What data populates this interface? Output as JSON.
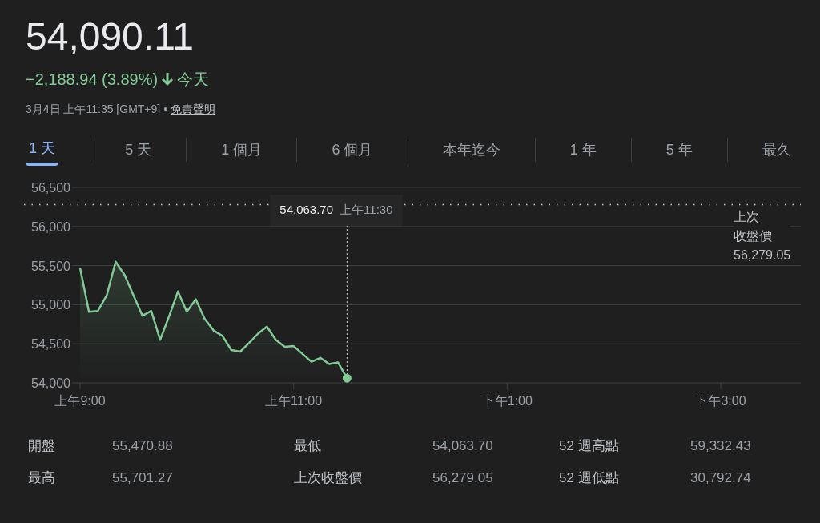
{
  "quote": {
    "price": "54,090.11",
    "change": "−2,188.94 (3.89%)",
    "period": "今天",
    "timestamp": "3月4日 上午11:35 [GMT+9]",
    "separator": "•",
    "disclaimer": "免責聲明"
  },
  "tabs": [
    {
      "label": "1 天",
      "selected": true
    },
    {
      "label": "5 天",
      "selected": false
    },
    {
      "label": "1 個月",
      "selected": false
    },
    {
      "label": "6 個月",
      "selected": false
    },
    {
      "label": "本年迄今",
      "selected": false
    },
    {
      "label": "1 年",
      "selected": false
    },
    {
      "label": "5 年",
      "selected": false
    },
    {
      "label": "最久",
      "selected": false
    }
  ],
  "chart": {
    "tooltip": {
      "value": "54,063.70",
      "time": "上午11:30"
    },
    "previous_close": {
      "label_lines": [
        "上次",
        "收盤價"
      ],
      "value": "56,279.05"
    },
    "chart_data": {
      "type": "line",
      "categories": [
        "上午9:00",
        null,
        null,
        null,
        null,
        null,
        null,
        null,
        null,
        null,
        null,
        null,
        null,
        null,
        null,
        null,
        null,
        null,
        null,
        null,
        null,
        null,
        null,
        null,
        "上午11:00",
        null,
        null,
        null,
        null,
        null,
        null,
        null,
        null,
        null,
        null,
        null,
        null,
        null,
        null,
        null,
        null,
        null,
        null,
        null,
        null,
        null,
        null,
        null,
        "下午1:00",
        null,
        null,
        null,
        null,
        null,
        null,
        null,
        null,
        null,
        null,
        null,
        null,
        null,
        null,
        null,
        null,
        null,
        null,
        null,
        null,
        null,
        null,
        null,
        "下午3:00",
        null,
        null,
        null,
        null,
        null,
        null,
        null,
        null,
        null
      ],
      "series": [
        {
          "color": "#81c995",
          "values": [
            55470,
            54910,
            54920,
            55120,
            55550,
            55380,
            55120,
            54860,
            54920,
            54550,
            54850,
            55170,
            54910,
            55070,
            54820,
            54670,
            54600,
            54420,
            54400,
            54510,
            54630,
            54720,
            54550,
            54460,
            54470,
            54370,
            54270,
            54320,
            54240,
            54260,
            54060,
            null,
            null,
            null,
            null,
            null,
            null,
            null,
            null,
            null,
            null,
            null,
            null,
            null,
            null,
            null,
            null,
            null,
            null,
            null,
            null,
            null,
            null,
            null,
            null,
            null,
            null,
            null,
            null,
            null,
            null,
            null,
            null,
            null,
            null,
            null,
            null,
            null,
            null,
            null,
            null,
            null,
            null,
            null,
            null,
            null,
            null,
            null,
            null,
            null,
            null,
            null
          ]
        }
      ],
      "ylim": [
        54000,
        56500
      ],
      "grid": true,
      "yticks": [
        {
          "value": 54000,
          "label": "54,000"
        },
        {
          "value": 54500,
          "label": "54,500"
        },
        {
          "value": 55000,
          "label": "55,000"
        },
        {
          "value": 55500,
          "label": "55,500"
        },
        {
          "value": 56000,
          "label": "56,000"
        },
        {
          "value": 56500,
          "label": "56,500"
        }
      ],
      "ref_lines": [
        {
          "axis": "y",
          "value": 56280
        }
      ]
    }
  },
  "stats": [
    {
      "label": "開盤",
      "value": "55,470.88"
    },
    {
      "label": "最低",
      "value": "54,063.70"
    },
    {
      "label": "52 週高點",
      "value": "59,332.43"
    },
    {
      "label": "最高",
      "value": "55,701.27"
    },
    {
      "label": "上次收盤價",
      "value": "56,279.05"
    },
    {
      "label": "52 週低點",
      "value": "30,792.74"
    }
  ]
}
